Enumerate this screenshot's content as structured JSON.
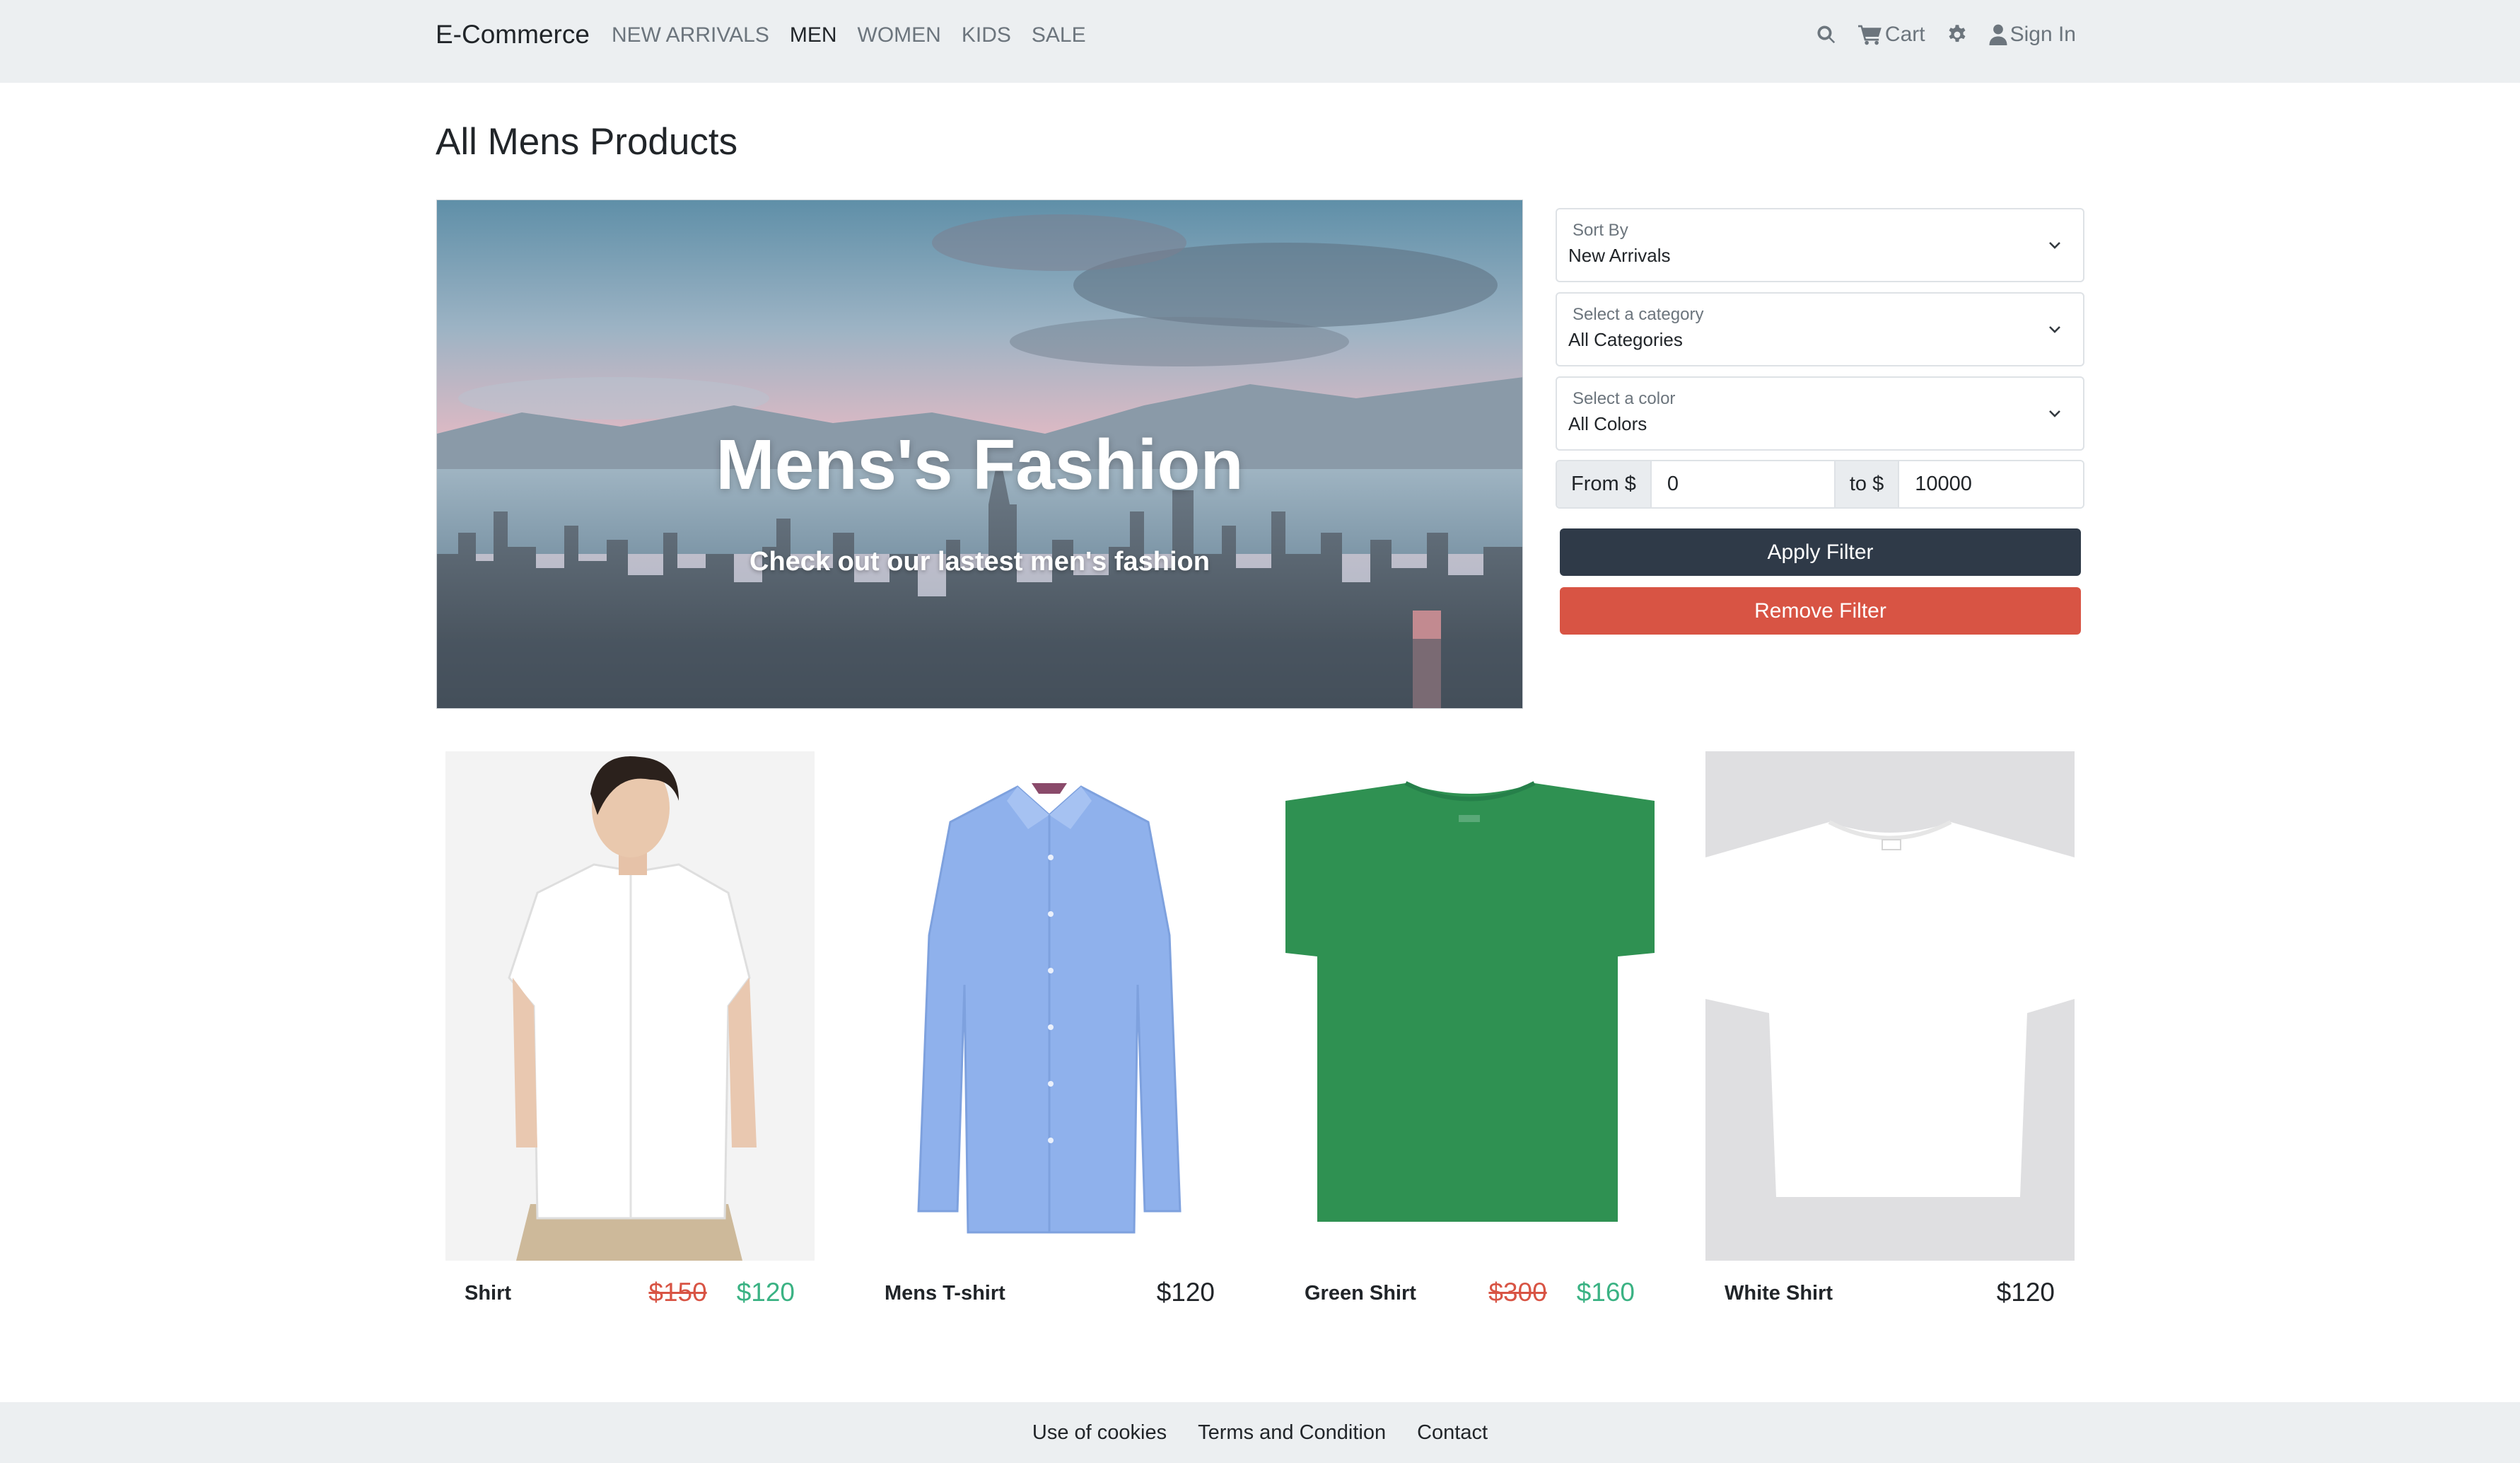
{
  "navbar": {
    "brand": "E-Commerce",
    "links": [
      "NEW ARRIVALS",
      "MEN",
      "WOMEN",
      "KIDS",
      "SALE"
    ],
    "active_link": "MEN",
    "cart_label": "Cart",
    "signin_label": "Sign In"
  },
  "page": {
    "title": "All Mens Products"
  },
  "hero": {
    "title": "Mens's Fashion",
    "subtitle": "Check out our lastest men's fashion"
  },
  "filters": {
    "sort": {
      "label": "Sort By",
      "value": "New Arrivals"
    },
    "category": {
      "label": "Select a category",
      "value": "All Categories"
    },
    "color": {
      "label": "Select a color",
      "value": "All Colors"
    },
    "price": {
      "from_label": "From $",
      "from_value": "0",
      "to_label": "to $",
      "to_value": "10000"
    },
    "apply_label": "Apply Filter",
    "remove_label": "Remove Filter"
  },
  "products": [
    {
      "name": "Shirt",
      "old_price": "$150",
      "price": "$120"
    },
    {
      "name": "Mens T-shirt",
      "price": "$120"
    },
    {
      "name": "Green Shirt",
      "old_price": "$300",
      "price": "$160"
    },
    {
      "name": "White Shirt",
      "price": "$120"
    }
  ],
  "footer": {
    "links": [
      "Use of cookies",
      "Terms and Condition",
      "Contact"
    ]
  },
  "colors": {
    "navbar_bg": "#eceff1",
    "apply_button": "#2f3a48",
    "remove_button": "#d85444",
    "old_price": "#d85444",
    "sale_price": "#3ab283"
  }
}
